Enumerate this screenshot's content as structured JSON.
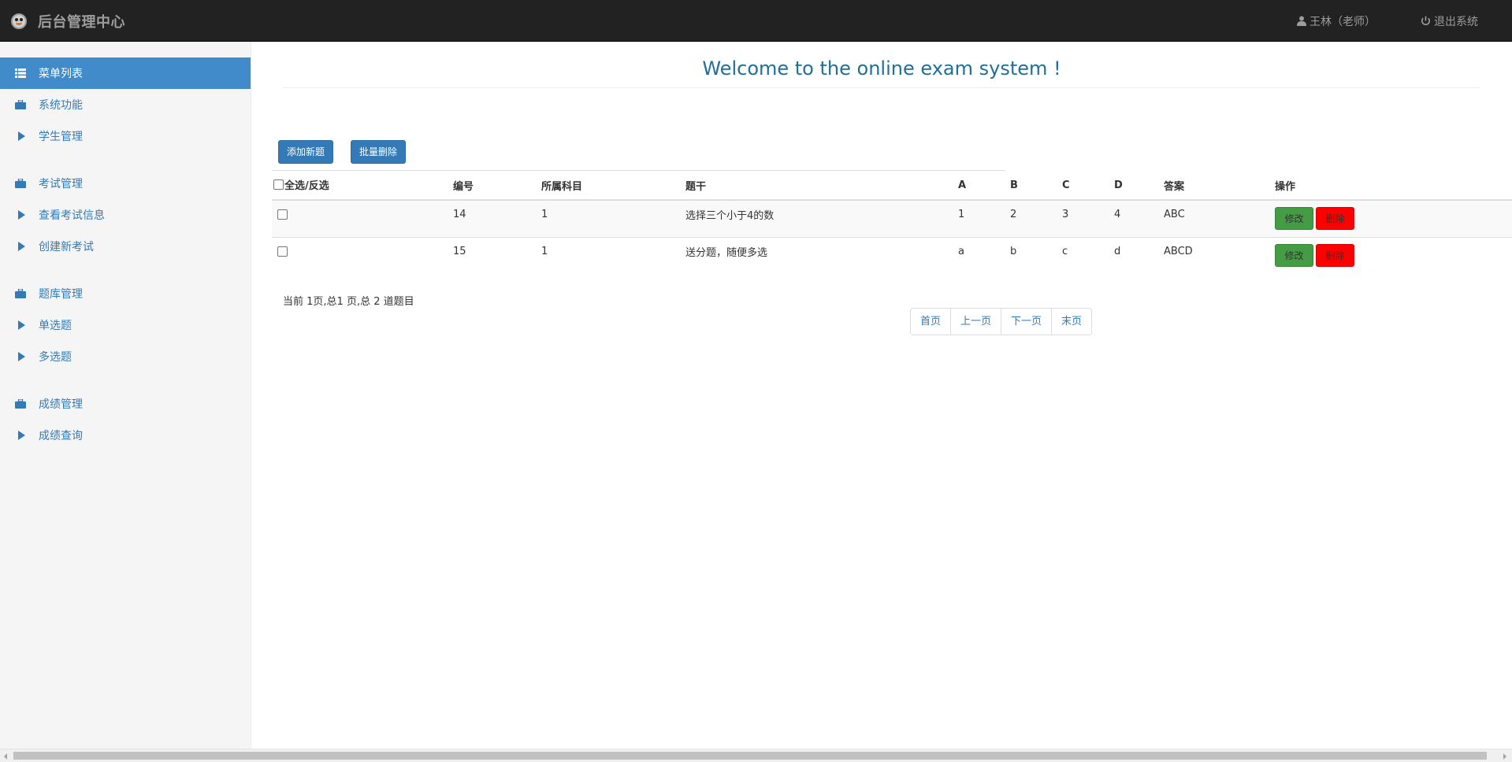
{
  "header": {
    "brand_title": "后台管理中心",
    "user_label": "王林（老师）",
    "logout_label": "退出系统"
  },
  "sidebar": {
    "items": [
      {
        "label": "菜单列表",
        "icon": "grid-list-icon",
        "active": true
      },
      {
        "label": "系统功能",
        "icon": "briefcase-icon"
      },
      {
        "label": "学生管理",
        "icon": "triangle-right-icon"
      },
      {
        "label": "考试管理",
        "icon": "briefcase-icon"
      },
      {
        "label": "查看考试信息",
        "icon": "triangle-right-icon"
      },
      {
        "label": "创建新考试",
        "icon": "triangle-right-icon"
      },
      {
        "label": "题库管理",
        "icon": "briefcase-icon"
      },
      {
        "label": "单选题",
        "icon": "triangle-right-icon"
      },
      {
        "label": "多选题",
        "icon": "triangle-right-icon"
      },
      {
        "label": "成绩管理",
        "icon": "briefcase-icon"
      },
      {
        "label": "成绩查询",
        "icon": "triangle-right-icon"
      }
    ]
  },
  "main": {
    "welcome": "Welcome to the online exam system !",
    "add_button": "添加新题",
    "batch_delete_button": "批量删除",
    "table": {
      "headers": {
        "select": "全选/反选",
        "id": "编号",
        "subject": "所属科目",
        "stem": "题干",
        "a": "A",
        "b": "B",
        "c": "C",
        "d": "D",
        "answer": "答案",
        "ops": "操作"
      },
      "rows": [
        {
          "id": "14",
          "subject": "1",
          "stem": "选择三个小于4的数",
          "a": "1",
          "b": "2",
          "c": "3",
          "d": "4",
          "answer": "ABC",
          "edit": "修改",
          "delete": "删除"
        },
        {
          "id": "15",
          "subject": "1",
          "stem": "送分题，随便多选",
          "a": "a",
          "b": "b",
          "c": "c",
          "d": "d",
          "answer": "ABCD",
          "edit": "修改",
          "delete": "删除"
        }
      ]
    },
    "page_info": "当前 1页,总1 页,总 2 道题目",
    "pager": {
      "first": "首页",
      "prev": "上一页",
      "next": "下一页",
      "last": "末页"
    }
  },
  "colors": {
    "navbar_bg": "#222222",
    "sidebar_active": "#428bca",
    "link": "#337ab7",
    "edit_button": "#449d44",
    "delete_button": "#ff0000"
  }
}
